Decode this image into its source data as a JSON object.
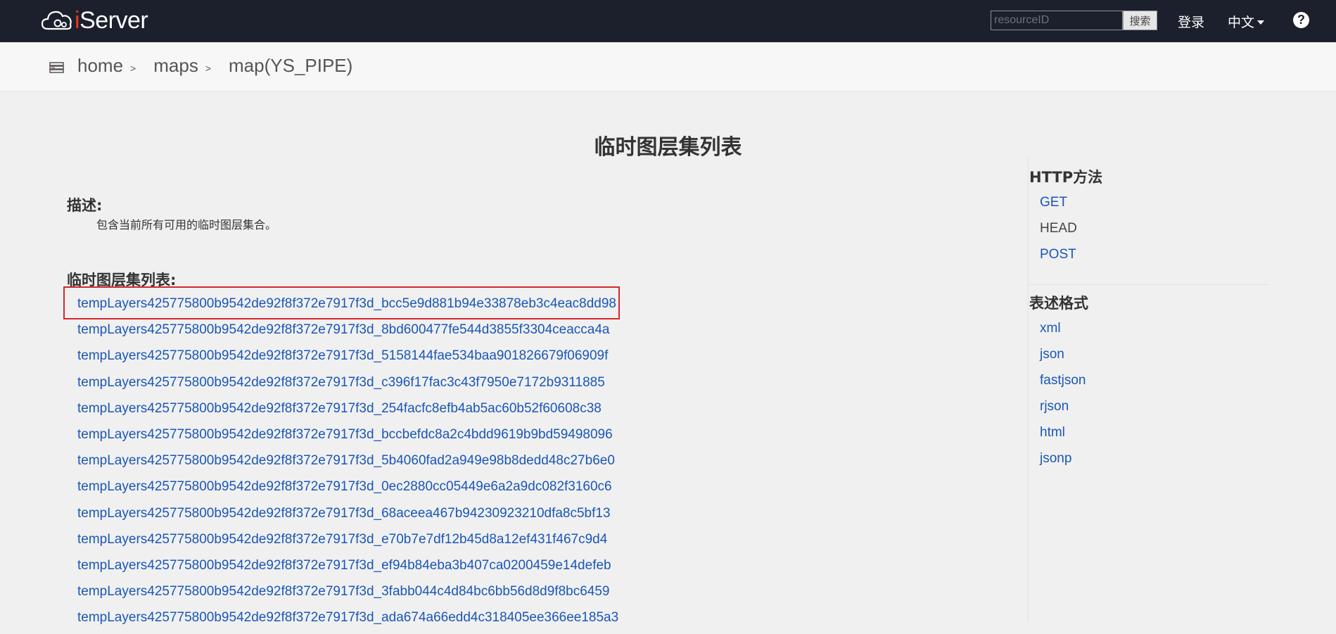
{
  "navbar": {
    "logo_i": "i",
    "logo_rest": "Server",
    "search_placeholder": "resourceID",
    "search_button": "搜索",
    "login": "登录",
    "language": "中文",
    "help": "?"
  },
  "breadcrumb": {
    "items": [
      "home",
      "maps",
      "map(YS_PIPE)"
    ],
    "separator": ">"
  },
  "main": {
    "title": "临时图层集列表",
    "description_heading": "描述:",
    "description_text": "包含当前所有可用的临时图层集合。",
    "list_heading": "临时图层集列表:",
    "layers": [
      "tempLayers425775800b9542de92f8f372e7917f3d_bcc5e9d881b94e33878eb3c4eac8dd98",
      "tempLayers425775800b9542de92f8f372e7917f3d_8bd600477fe544d3855f3304ceacca4a",
      "tempLayers425775800b9542de92f8f372e7917f3d_5158144fae534baa901826679f06909f",
      "tempLayers425775800b9542de92f8f372e7917f3d_c396f17fac3c43f7950e7172b9311885",
      "tempLayers425775800b9542de92f8f372e7917f3d_254facfc8efb4ab5ac60b52f60608c38",
      "tempLayers425775800b9542de92f8f372e7917f3d_bccbefdc8a2c4bdd9619b9bd59498096",
      "tempLayers425775800b9542de92f8f372e7917f3d_5b4060fad2a949e98b8dedd48c27b6e0",
      "tempLayers425775800b9542de92f8f372e7917f3d_0ec2880cc05449e6a2a9dc082f3160c6",
      "tempLayers425775800b9542de92f8f372e7917f3d_68aceea467b94230923210dfa8c5bf13",
      "tempLayers425775800b9542de92f8f372e7917f3d_e70b7e7df12b45d8a12ef431f467c9d4",
      "tempLayers425775800b9542de92f8f372e7917f3d_ef94b84eba3b407ca0200459e14defeb",
      "tempLayers425775800b9542de92f8f372e7917f3d_3fabb044c4d84bc6bb56d8d9f8bc6459",
      "tempLayers425775800b9542de92f8f372e7917f3d_ada674a66edd4c318405ee366ee185a3"
    ]
  },
  "sidebar": {
    "http_heading": "HTTP方法",
    "http_methods": [
      "GET",
      "HEAD",
      "POST"
    ],
    "format_heading": "表述格式",
    "formats": [
      "xml",
      "json",
      "fastjson",
      "rjson",
      "html",
      "jsonp"
    ]
  },
  "colors": {
    "navbar_bg": "#1b202c",
    "link": "#1a56b8",
    "highlight": "#d9262c",
    "logo_accent": "#e8372c"
  }
}
